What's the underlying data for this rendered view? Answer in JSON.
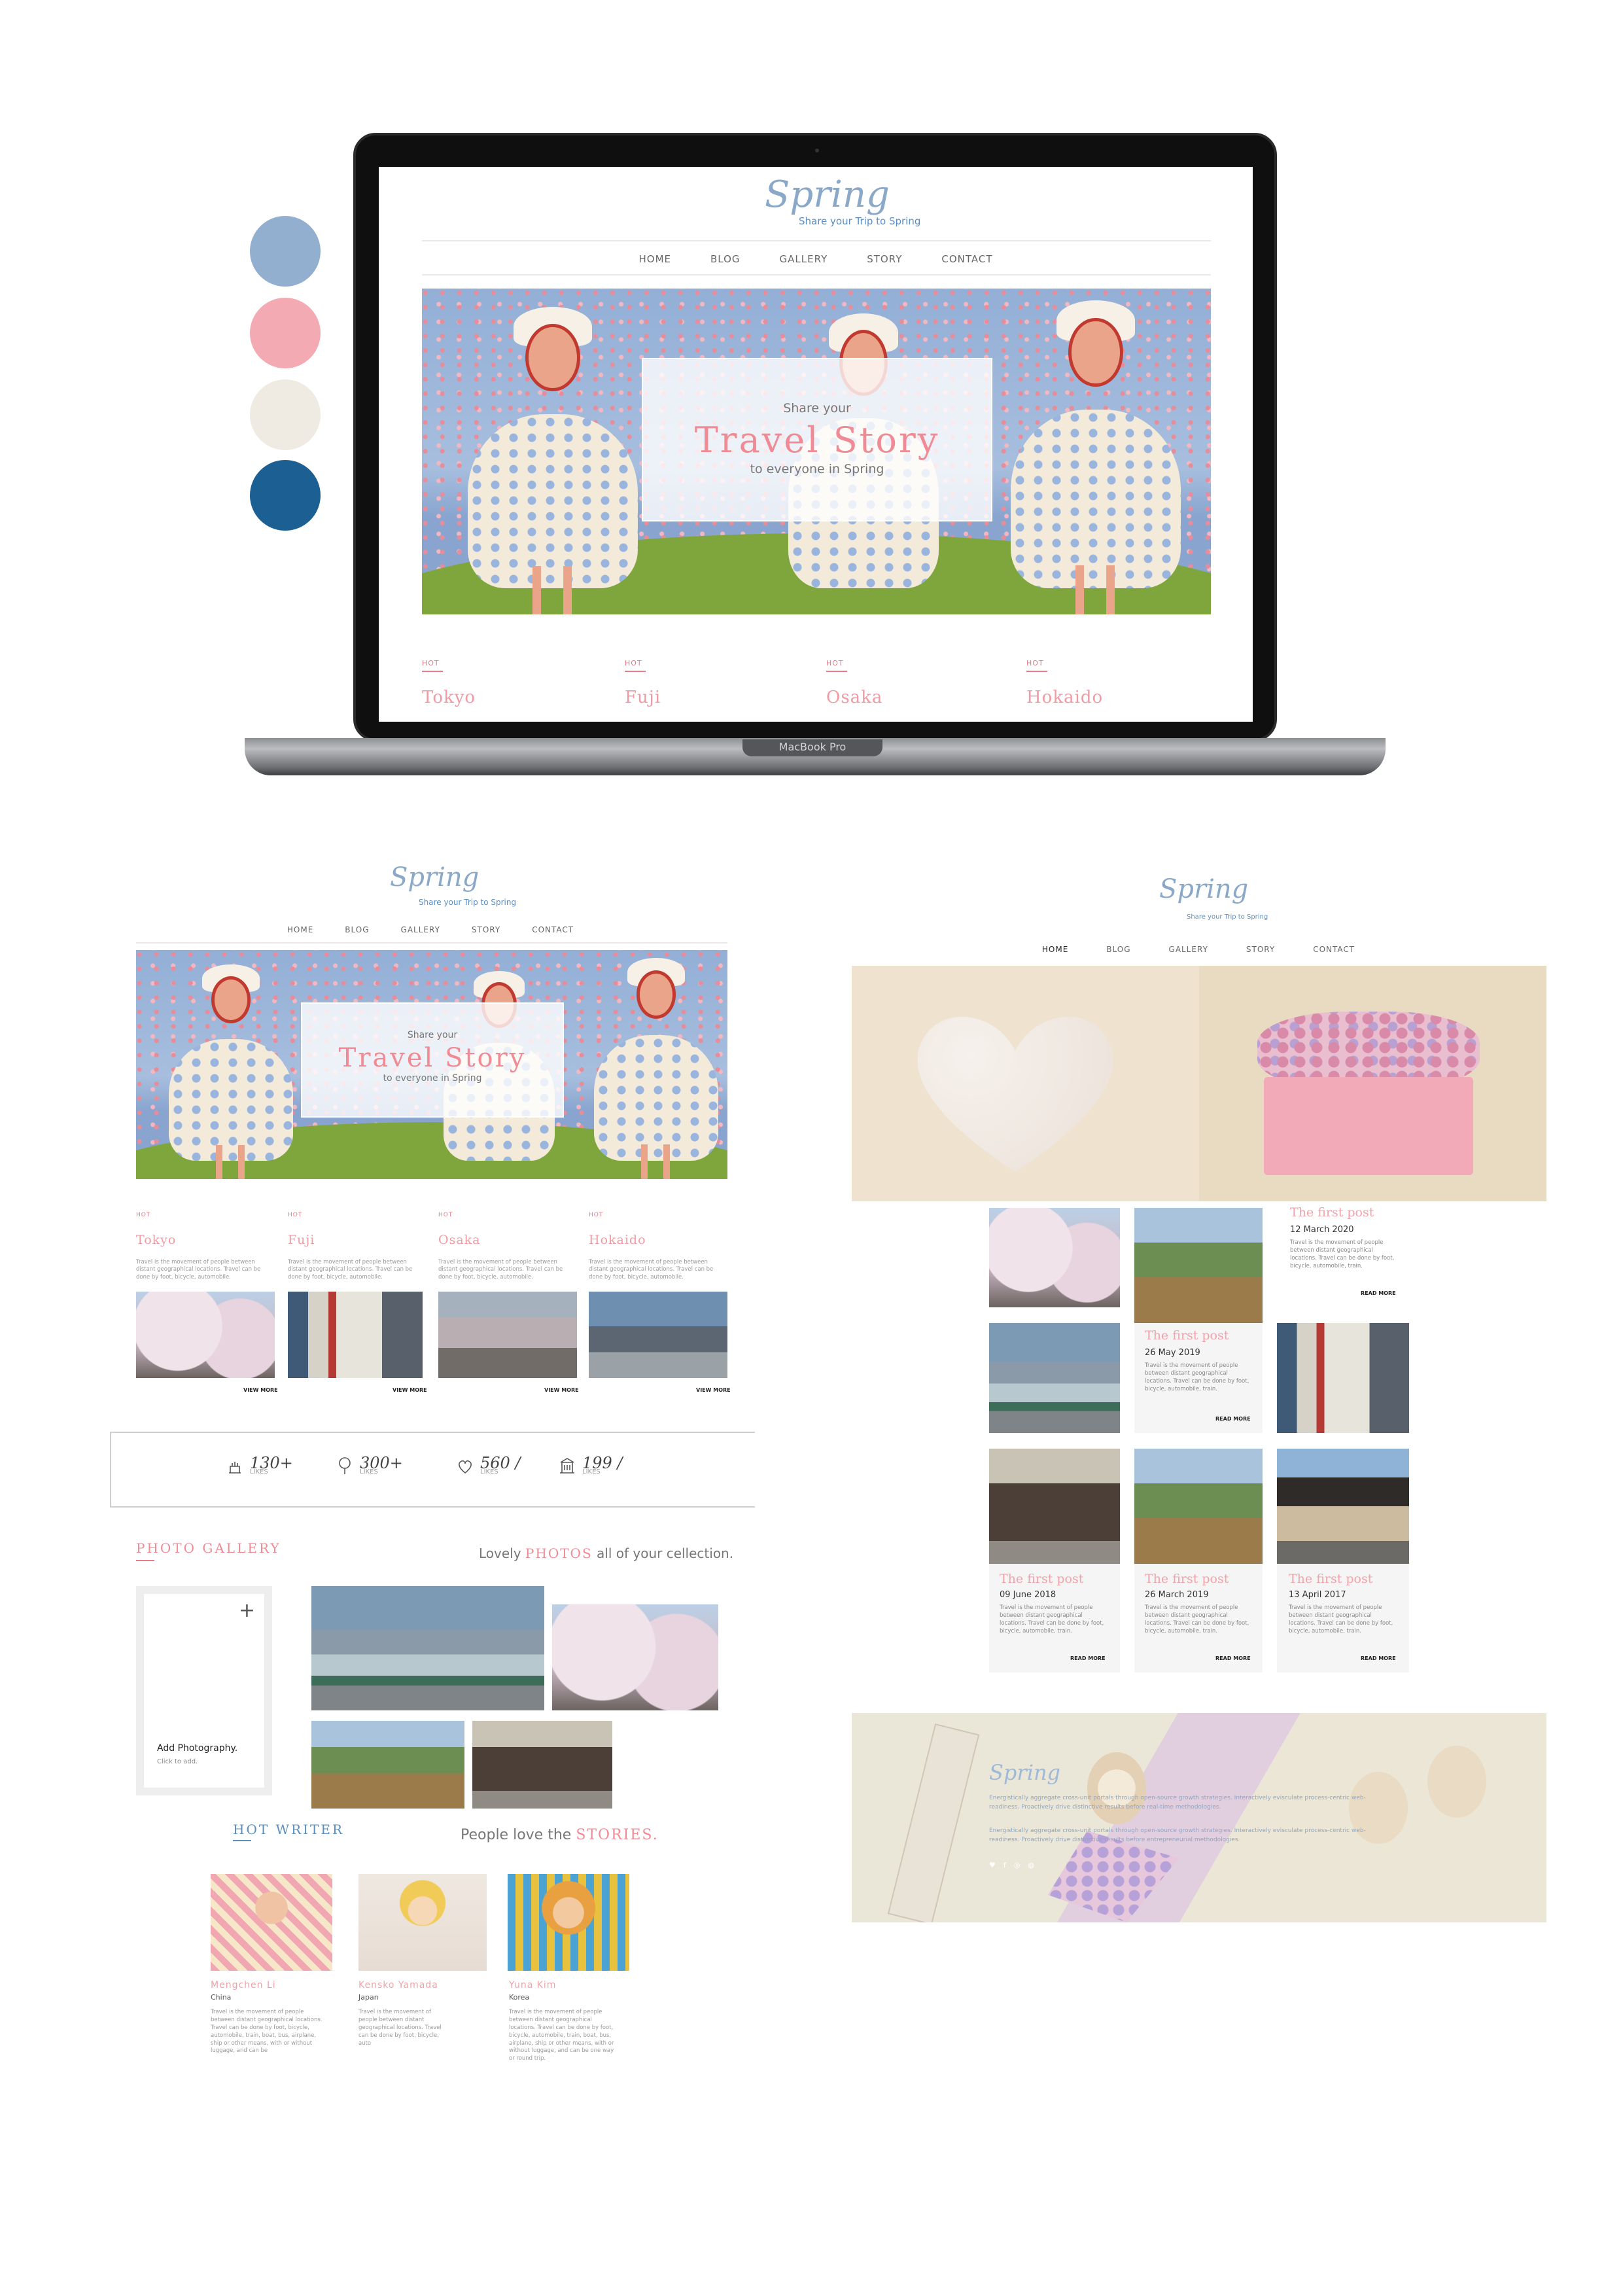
{
  "palette": [
    "#93afd0",
    "#f4aab2",
    "#efebe3",
    "#1b5f93"
  ],
  "site": {
    "logo": "Spring",
    "tagline": "Share your Trip to Spring",
    "nav": [
      "HOME",
      "BLOG",
      "GALLERY",
      "STORY",
      "CONTACT"
    ],
    "hero": {
      "line1": "Share your",
      "title": "Travel Story",
      "line2": "to everyone in Spring"
    },
    "hot": [
      {
        "label": "HOT",
        "city": "Tokyo",
        "desc": "Travel is the movement of people between distant geographical locations. Travel can be done by foot, bicycle, automobile.",
        "more": "VIEW MORE"
      },
      {
        "label": "HOT",
        "city": "Fuji",
        "desc": "Travel is the movement of people between distant geographical locations. Travel can be done by foot, bicycle, automobile.",
        "more": "VIEW MORE"
      },
      {
        "label": "HOT",
        "city": "Osaka",
        "desc": "Travel is the movement of people between distant geographical locations. Travel can be done by foot, bicycle, automobile.",
        "more": "VIEW MORE"
      },
      {
        "label": "HOT",
        "city": "Hokaido",
        "desc": "Travel is the movement of people between distant geographical locations. Travel can be done by foot, bicycle, automobile.",
        "more": "VIEW MORE"
      }
    ],
    "stats": [
      {
        "value": "130+",
        "label": "LIKES"
      },
      {
        "value": "300+",
        "label": "LIKES"
      },
      {
        "value": "560 /",
        "label": "LIKES"
      },
      {
        "value": "199 /",
        "label": "LIKES"
      }
    ],
    "gallery": {
      "heading": "PHOTO GALLERY",
      "sub_pre": "Lovely ",
      "sub_em": "PHOTOS",
      "sub_post": " all of your cellection.",
      "add_title": "Add Photography.",
      "add_hint": "Click to add.",
      "add_plus": "+"
    },
    "writers": {
      "heading": "HOT WRITER",
      "sub_pre": "People love the ",
      "sub_em": "STORIES.",
      "items": [
        {
          "name": "Mengchen Li",
          "country": "China",
          "desc": "Travel is the movement of people between distant geographical locations. Travel can be done by foot, bicycle, automobile, train, boat, bus, airplane, ship or other means, with or without luggage, and can be"
        },
        {
          "name": "Kensko Yamada",
          "country": "Japan",
          "desc": "Travel is the movement of people between distant geographical locations. Travel can be done by foot, bicycle, auto"
        },
        {
          "name": "Yuna Kim",
          "country": "Korea",
          "desc": "Travel is the movement of people between distant geographical locations. Travel can be done by foot, bicycle, automobile, train, boat, bus, airplane, ship or other means, with or without luggage, and can be one way or round trip."
        }
      ]
    },
    "blog": {
      "post_title": "The first post",
      "posts": [
        {
          "date": "12 March 2020",
          "desc": "Travel is the movement of people between distant geographical locations. Travel can be done by foot, bicycle, automobile, train."
        },
        {
          "date": "26 May 2019",
          "desc": "Travel is the movement of people between distant geographical locations. Travel can be done by foot, bicycle, automobile, train."
        },
        {
          "date": "09 June 2018",
          "desc": "Travel is the movement of people between distant geographical locations. Travel can be done by foot, bicycle, automobile, train."
        },
        {
          "date": "26 March 2019",
          "desc": "Travel is the movement of people between distant geographical locations. Travel can be done by foot, bicycle, automobile, train."
        },
        {
          "date": "13 April 2017",
          "desc": "Travel is the movement of people between distant geographical locations. Travel can be done by foot, bicycle, automobile, train."
        }
      ],
      "read_more": "READ MORE",
      "footer_logo": "Spring",
      "footer_p1": "Energistically aggregate cross-unit portals through open-source growth strategies. Interactively evisculate process-centric web-readiness. Proactively drive distinctive results before real-time methodologies.",
      "footer_p2": "Energistically aggregate cross-unit portals through open-source growth strategies. Interactively evisculate process-centric web-readiness. Proactively drive distinctive results before entrepreneurial methodologies.",
      "social": [
        "♥",
        "f",
        "◎",
        "◍"
      ]
    }
  },
  "device_label": "MacBook Pro"
}
